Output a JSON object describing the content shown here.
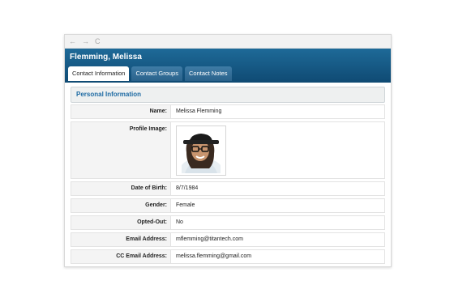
{
  "browser": {
    "back_icon": "←",
    "forward_icon": "→",
    "reload_icon": "C"
  },
  "header": {
    "title": "Flemming, Melissa"
  },
  "tabs": [
    {
      "label": "Contact Information",
      "active": true
    },
    {
      "label": "Contact Groups",
      "active": false
    },
    {
      "label": "Contact Notes",
      "active": false
    }
  ],
  "section": {
    "title": "Personal Information"
  },
  "fields": {
    "name": {
      "label": "Name:",
      "value": "Melissa Flemming"
    },
    "profile_image": {
      "label": "Profile Image:"
    },
    "dob": {
      "label": "Date of Birth:",
      "value": "8/7/1984"
    },
    "gender": {
      "label": "Gender:",
      "value": "Female"
    },
    "opted_out": {
      "label": "Opted-Out:",
      "value": "No"
    },
    "email": {
      "label": "Email Address:",
      "value": "mflemming@titantech.com"
    },
    "cc_email": {
      "label": "CC Email Address:",
      "value": "melissa.flemming@gmail.com"
    }
  },
  "colors": {
    "header_bg": "#0f4a73",
    "section_title": "#1d6aa3"
  }
}
